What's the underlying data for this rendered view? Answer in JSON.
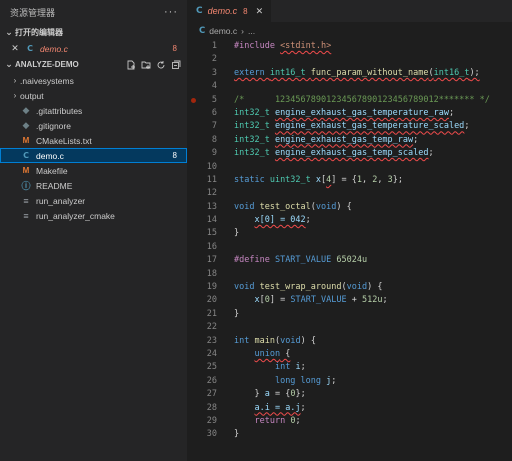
{
  "sidebar": {
    "title": "资源管理器",
    "more_label": "···",
    "open_editors": {
      "header": "打开的编辑器",
      "items": [
        {
          "close": "✕",
          "icon": "C",
          "name": "demo.c",
          "badge": "8"
        }
      ]
    },
    "project": {
      "header": "ANALYZE-DEMO",
      "items": [
        {
          "chevron": "›",
          "icon": "",
          "name": ".naivesystems",
          "badge": ""
        },
        {
          "chevron": "›",
          "icon": "",
          "name": "output",
          "badge": ""
        },
        {
          "chevron": "",
          "icon": "◆",
          "name": ".gitattributes",
          "badge": ""
        },
        {
          "chevron": "",
          "icon": "◆",
          "name": ".gitignore",
          "badge": ""
        },
        {
          "chevron": "",
          "icon": "M",
          "name": "CMakeLists.txt",
          "badge": ""
        },
        {
          "chevron": "",
          "icon": "C",
          "name": "demo.c",
          "badge": "8"
        },
        {
          "chevron": "",
          "icon": "M",
          "name": "Makefile",
          "badge": ""
        },
        {
          "chevron": "",
          "icon": "ⓘ",
          "name": "README",
          "badge": ""
        },
        {
          "chevron": "",
          "icon": "≡",
          "name": "run_analyzer",
          "badge": ""
        },
        {
          "chevron": "",
          "icon": "≡",
          "name": "run_analyzer_cmake",
          "badge": ""
        }
      ]
    }
  },
  "editor": {
    "tab": {
      "icon": "C",
      "name": "demo.c",
      "count": "8",
      "close": "✕"
    },
    "breadcrumb": {
      "icon": "C",
      "file": "demo.c",
      "sep": "›",
      "more": "..."
    },
    "lines": [
      {
        "n": "1",
        "t": [
          [
            "p",
            "#include "
          ],
          [
            "s sq",
            "<stdint.h>"
          ]
        ]
      },
      {
        "n": "2",
        "t": []
      },
      {
        "n": "3",
        "t": [
          [
            "k sq",
            "extern "
          ],
          [
            "t sq",
            "int16_t "
          ],
          [
            "f sq",
            "func_param_without_name"
          ],
          [
            "sq",
            "("
          ],
          [
            "t sq",
            "int16_t"
          ],
          [
            "sq",
            ");"
          ]
        ]
      },
      {
        "n": "4",
        "t": []
      },
      {
        "n": "5",
        "bp": true,
        "t": [
          [
            "c",
            "/*      12345678901234567890123456789012******* */"
          ]
        ]
      },
      {
        "n": "6",
        "t": [
          [
            "t",
            "int32_t "
          ],
          [
            "v sq",
            "engine_exhaust_gas_temperature_raw"
          ],
          [
            "",
            ";"
          ]
        ]
      },
      {
        "n": "7",
        "t": [
          [
            "t",
            "int32_t "
          ],
          [
            "v sq",
            "engine_exhaust_gas_temperature_scaled"
          ],
          [
            "",
            ";"
          ]
        ]
      },
      {
        "n": "8",
        "t": [
          [
            "t",
            "int32_t "
          ],
          [
            "v sq",
            "engine_exhaust_gas_temp_raw"
          ],
          [
            "",
            ";"
          ]
        ]
      },
      {
        "n": "9",
        "t": [
          [
            "t",
            "int32_t "
          ],
          [
            "v sq",
            "engine_exhaust_gas_temp_scaled"
          ],
          [
            "",
            ";"
          ]
        ]
      },
      {
        "n": "10",
        "t": []
      },
      {
        "n": "11",
        "t": [
          [
            "k",
            "static "
          ],
          [
            "t",
            "uint32_t "
          ],
          [
            "v",
            "x"
          ],
          [
            "",
            "["
          ],
          [
            "n sq",
            "4"
          ],
          [
            "",
            "] = {"
          ],
          [
            "n",
            "1"
          ],
          [
            "",
            ", "
          ],
          [
            "n",
            "2"
          ],
          [
            "",
            ", "
          ],
          [
            "n",
            "3"
          ],
          [
            "",
            "};"
          ]
        ]
      },
      {
        "n": "12",
        "t": []
      },
      {
        "n": "13",
        "t": [
          [
            "k",
            "void "
          ],
          [
            "f",
            "test_octal"
          ],
          [
            "",
            "("
          ],
          [
            "k",
            "void"
          ],
          [
            "",
            ") {"
          ]
        ]
      },
      {
        "n": "14",
        "t": [
          [
            "",
            "    "
          ],
          [
            "v sq",
            "x[0] = 042"
          ],
          [
            "",
            ";"
          ]
        ]
      },
      {
        "n": "15",
        "t": [
          [
            "",
            "}"
          ]
        ]
      },
      {
        "n": "16",
        "t": []
      },
      {
        "n": "17",
        "t": [
          [
            "p",
            "#define "
          ],
          [
            "d",
            "START_VALUE "
          ],
          [
            "n",
            "65024u"
          ]
        ]
      },
      {
        "n": "18",
        "t": []
      },
      {
        "n": "19",
        "t": [
          [
            "k",
            "void "
          ],
          [
            "f",
            "test_wrap_around"
          ],
          [
            "",
            "("
          ],
          [
            "k",
            "void"
          ],
          [
            "",
            ") {"
          ]
        ]
      },
      {
        "n": "20",
        "t": [
          [
            "",
            "    "
          ],
          [
            "v",
            "x"
          ],
          [
            "",
            "["
          ],
          [
            "n",
            "0"
          ],
          [
            "",
            "] = "
          ],
          [
            "d",
            "START_VALUE"
          ],
          [
            "",
            " + "
          ],
          [
            "n",
            "512u"
          ],
          [
            "",
            ";"
          ]
        ]
      },
      {
        "n": "21",
        "t": [
          [
            "",
            "}"
          ]
        ]
      },
      {
        "n": "22",
        "t": []
      },
      {
        "n": "23",
        "t": [
          [
            "k",
            "int "
          ],
          [
            "f",
            "main"
          ],
          [
            "",
            "("
          ],
          [
            "k",
            "void"
          ],
          [
            "",
            ") {"
          ]
        ]
      },
      {
        "n": "24",
        "t": [
          [
            "",
            "    "
          ],
          [
            "k sq",
            "union"
          ],
          [
            "sq",
            " {"
          ]
        ]
      },
      {
        "n": "25",
        "t": [
          [
            "",
            "        "
          ],
          [
            "k",
            "int "
          ],
          [
            "v",
            "i"
          ],
          [
            "",
            ";"
          ]
        ]
      },
      {
        "n": "26",
        "t": [
          [
            "",
            "        "
          ],
          [
            "k",
            "long long "
          ],
          [
            "v",
            "j"
          ],
          [
            "",
            ";"
          ]
        ]
      },
      {
        "n": "27",
        "t": [
          [
            "",
            "    } "
          ],
          [
            "v",
            "a"
          ],
          [
            "",
            " = {"
          ],
          [
            "n",
            "0"
          ],
          [
            "",
            "};"
          ]
        ]
      },
      {
        "n": "28",
        "t": [
          [
            "",
            "    "
          ],
          [
            "v sq",
            "a.i = a.j"
          ],
          [
            "",
            ";"
          ]
        ]
      },
      {
        "n": "29",
        "t": [
          [
            "",
            "    "
          ],
          [
            "p",
            "return "
          ],
          [
            "n",
            "0"
          ],
          [
            "",
            ";"
          ]
        ]
      },
      {
        "n": "30",
        "t": [
          [
            "",
            "}"
          ]
        ]
      }
    ]
  }
}
